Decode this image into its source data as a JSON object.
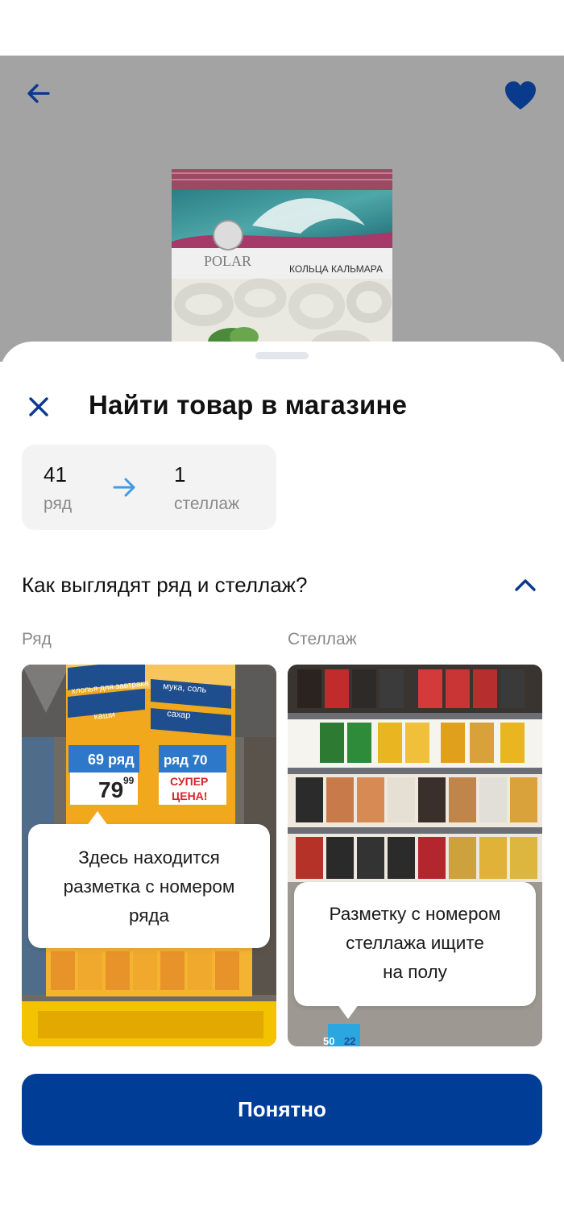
{
  "product_screen": {
    "back_icon": "arrow-left-icon",
    "favorite_icon": "heart-icon",
    "package_brand": "POLAR",
    "package_text": "КОЛЬЦА КАЛЬМАРА",
    "accent_color": "#0a3a8c"
  },
  "sheet": {
    "title": "Найти товар в магазине",
    "close_icon": "close-icon",
    "location": {
      "row_number": "41",
      "row_label": "ряд",
      "shelf_number": "1",
      "shelf_label": "стеллаж"
    },
    "question": "Как выглядят ряд и стеллаж?",
    "row_column": {
      "label": "Ряд",
      "sign_texts": [
        "хлопья для завтрака",
        "мука, соль",
        "каши",
        "сахар",
        "69 ряд",
        "ряд 70",
        "79",
        "99",
        "СУПЕР",
        "ЦЕНА!"
      ],
      "bubble_lines": [
        "Здесь находится",
        "разметка с номером",
        "ряда"
      ]
    },
    "shelf_column": {
      "label": "Стеллаж",
      "floor_marks": [
        "50",
        "22"
      ],
      "bubble_lines": [
        "Разметку с номером",
        "стеллажа ищите",
        "на полу"
      ]
    },
    "confirm_button": "Понятно",
    "colors": {
      "primary": "#003d96",
      "arrow": "#3d9be9",
      "muted_text": "#8a8a8a",
      "card_bg": "#f3f3f3"
    }
  }
}
